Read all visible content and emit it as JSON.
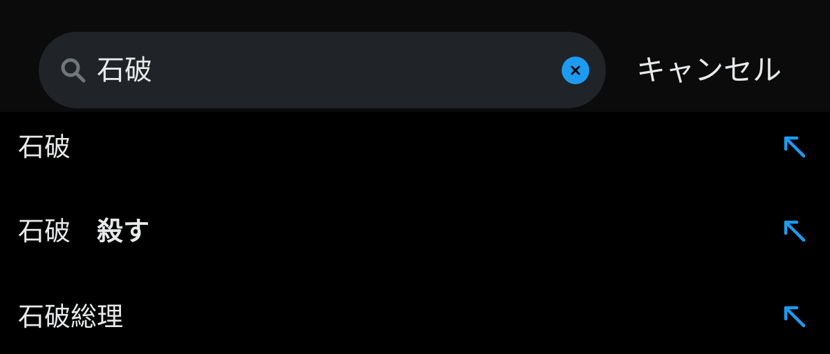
{
  "search": {
    "value": "石破",
    "clear_icon": "x-icon",
    "search_icon": "magnifier-icon"
  },
  "cancel_label": "キャンセル",
  "suggestions": [
    {
      "prefix": "石破",
      "suffix": ""
    },
    {
      "prefix": "石破　",
      "suffix": "殺す"
    },
    {
      "prefix": "石破",
      "suffix": "総理"
    }
  ],
  "colors": {
    "accent": "#1d9bf0",
    "background": "#000000",
    "header_background": "#0b0b0c",
    "pill_background": "#202327",
    "text": "#e7e9ea",
    "icon_gray": "#71767b"
  }
}
